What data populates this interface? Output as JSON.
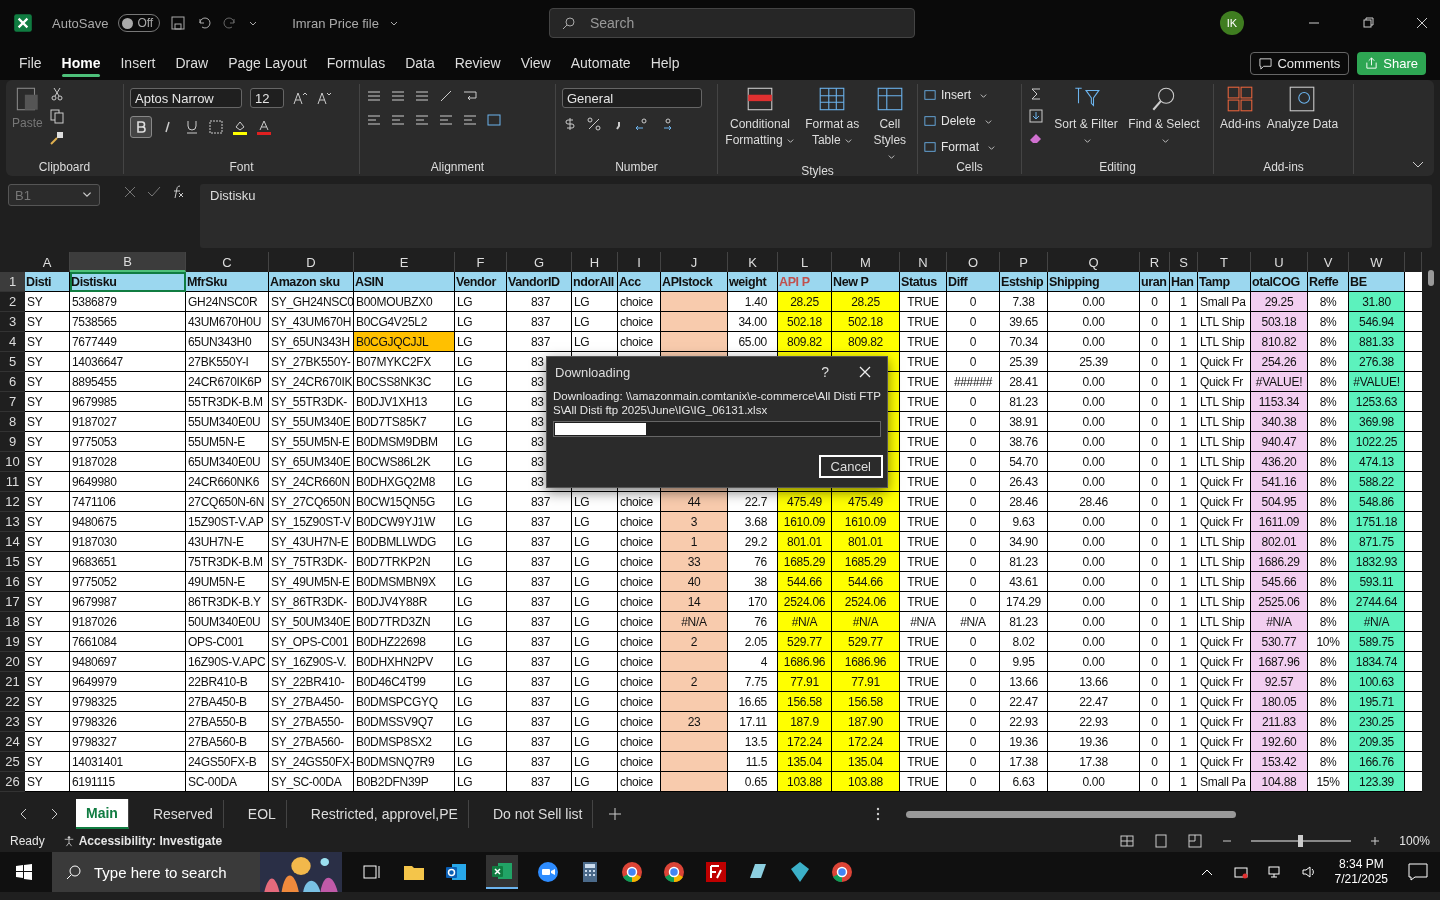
{
  "title_bar": {
    "autosave_label": "AutoSave",
    "autosave_on": false,
    "autosave_state": "Off",
    "file_name": "Imran Price file",
    "search_placeholder": "Search",
    "avatar": "IK"
  },
  "menu_tabs": [
    {
      "label": "File",
      "selected": false
    },
    {
      "label": "Home",
      "selected": true
    },
    {
      "label": "Insert",
      "selected": false
    },
    {
      "label": "Draw",
      "selected": false
    },
    {
      "label": "Page Layout",
      "selected": false
    },
    {
      "label": "Formulas",
      "selected": false
    },
    {
      "label": "Data",
      "selected": false
    },
    {
      "label": "Review",
      "selected": false
    },
    {
      "label": "View",
      "selected": false
    },
    {
      "label": "Automate",
      "selected": false
    },
    {
      "label": "Help",
      "selected": false
    }
  ],
  "comments_button": "Comments",
  "share_button": "Share",
  "ribbon": {
    "clipboard": {
      "paste": "Paste",
      "paste_disabled": true,
      "label": "Clipboard"
    },
    "font": {
      "family": "Aptos Narrow",
      "size": "12",
      "bold": true,
      "label": "Font"
    },
    "alignment": {
      "label": "Alignment"
    },
    "number": {
      "format": "General",
      "label": "Number"
    },
    "styles": {
      "buttons": [
        "Conditional Formatting",
        "Format as Table",
        "Cell Styles"
      ],
      "label": "Styles"
    },
    "cells": {
      "buttons": [
        "Insert",
        "Delete",
        "Format"
      ],
      "label": "Cells"
    },
    "editing": {
      "buttons": [
        "Sort & Filter",
        "Find & Select"
      ],
      "label": "Editing"
    },
    "addins": {
      "buttons": [
        "Add-ins",
        "Analyze Data"
      ],
      "label": "Add-ins"
    }
  },
  "formula_bar": {
    "name_box": "B1",
    "content": "Distisku"
  },
  "columns": [
    {
      "letter": "A",
      "header": "Disti",
      "selected": false
    },
    {
      "letter": "B",
      "header": "Distisku",
      "selected": true
    },
    {
      "letter": "C",
      "header": "MfrSku",
      "selected": false
    },
    {
      "letter": "D",
      "header": "Amazon sku",
      "selected": false
    },
    {
      "letter": "E",
      "header": "ASIN",
      "selected": false
    },
    {
      "letter": "F",
      "header": "Vendor",
      "selected": false
    },
    {
      "letter": "G",
      "header": "VandorID",
      "selected": false
    },
    {
      "letter": "H",
      "header": "ndorAll",
      "selected": false
    },
    {
      "letter": "I",
      "header": "Acc",
      "selected": false
    },
    {
      "letter": "J",
      "header": "APIstock",
      "selected": false,
      "color": "#f8cbad"
    },
    {
      "letter": "K",
      "header": "weight",
      "selected": false
    },
    {
      "letter": "L",
      "header": "API P",
      "selected": false,
      "color": "#ffff00",
      "header_emphasis": true
    },
    {
      "letter": "M",
      "header": "New P",
      "selected": false,
      "color": "#ffff00"
    },
    {
      "letter": "N",
      "header": "Status",
      "selected": false
    },
    {
      "letter": "O",
      "header": "Diff",
      "selected": false
    },
    {
      "letter": "P",
      "header": "Estship",
      "selected": false
    },
    {
      "letter": "Q",
      "header": "Shipping",
      "selected": false
    },
    {
      "letter": "R",
      "header": "uran",
      "selected": false
    },
    {
      "letter": "S",
      "header": "Han",
      "selected": false
    },
    {
      "letter": "T",
      "header": "Tamp",
      "selected": false
    },
    {
      "letter": "U",
      "header": "otalCOG",
      "selected": false,
      "color": "#f2cef0"
    },
    {
      "letter": "V",
      "header": "Reffe",
      "selected": false
    },
    {
      "letter": "W",
      "header": "BE",
      "selected": false,
      "color": "#5cf2bd"
    }
  ],
  "rows": [
    {
      "n": "2",
      "cells": [
        "SY",
        "5386879",
        "GH24NSC0R",
        "SY_GH24NSC0",
        "B00MOUBZX0",
        "LG",
        "837",
        "LG",
        "choice",
        null,
        "1.40",
        "28.25",
        "28.25",
        "TRUE",
        "0",
        "7.38",
        "0.00",
        "0",
        "1",
        "Small Pa",
        "29.25",
        "8%",
        "31.80"
      ]
    },
    {
      "n": "3",
      "cells": [
        "SY",
        "7538565",
        "43UM670H0U",
        "SY_43UM670H",
        "B0CG4V25L2",
        "LG",
        "837",
        "LG",
        "choice",
        null,
        "34.00",
        "502.18",
        "502.18",
        "TRUE",
        "0",
        "39.65",
        "0.00",
        "0",
        "1",
        "LTL Ship",
        "503.18",
        "8%",
        "546.94"
      ]
    },
    {
      "n": "4",
      "cells": [
        "SY",
        "7677449",
        "65UN343H0",
        "SY_65UN343H",
        {
          "text": "B0CGJQCJJL",
          "highlighted": true
        },
        "LG",
        "837",
        "LG",
        "choice",
        null,
        "65.00",
        "809.82",
        "809.82",
        "TRUE",
        "0",
        "70.34",
        "0.00",
        "0",
        "1",
        "LTL Ship",
        "810.82",
        "8%",
        "881.33"
      ]
    },
    {
      "n": "5",
      "cells": [
        "SY",
        "14036647",
        "27BK550Y-I",
        "SY_27BK550Y-",
        "B07MYKC2FX",
        "LG",
        "83",
        null,
        null,
        null,
        null,
        null,
        null,
        "TRUE",
        "0",
        "25.39",
        "25.39",
        "0",
        "1",
        "Quick Fr",
        "254.26",
        "8%",
        "276.38"
      ]
    },
    {
      "n": "6",
      "cells": [
        "SY",
        "8895455",
        "24CR670IK6P",
        "SY_24CR670IK",
        "B0CSS8NK3C",
        "LG",
        "83",
        null,
        null,
        null,
        null,
        null,
        null,
        "TRUE",
        "######",
        "28.41",
        "0.00",
        "0",
        "1",
        "Quick Fr",
        "#VALUE!",
        "8%",
        "#VALUE!"
      ]
    },
    {
      "n": "7",
      "cells": [
        "SY",
        "9679985",
        "55TR3DK-B.M",
        "SY_55TR3DK-",
        "B0DJV1XH13",
        "LG",
        "83",
        null,
        null,
        null,
        null,
        null,
        null,
        "TRUE",
        "0",
        "81.23",
        "0.00",
        "0",
        "1",
        "LTL Ship",
        "1153.34",
        "8%",
        "1253.63"
      ]
    },
    {
      "n": "8",
      "cells": [
        "SY",
        "9187027",
        "55UM340E0U",
        "SY_55UM340E",
        "B0D7TS85K7",
        "LG",
        "83",
        null,
        null,
        null,
        null,
        null,
        null,
        "TRUE",
        "0",
        "38.91",
        "0.00",
        "0",
        "1",
        "LTL Ship",
        "340.38",
        "8%",
        "369.98"
      ]
    },
    {
      "n": "9",
      "cells": [
        "SY",
        "9775053",
        "55UM5N-E",
        "SY_55UM5N-E",
        "B0DMSM9DBM",
        "LG",
        "83",
        null,
        null,
        null,
        null,
        null,
        null,
        "TRUE",
        "0",
        "38.76",
        "0.00",
        "0",
        "1",
        "LTL Ship",
        "940.47",
        "8%",
        "1022.25"
      ]
    },
    {
      "n": "10",
      "cells": [
        "SY",
        "9187028",
        "65UM340E0U",
        "SY_65UM340E",
        "B0CWS86L2K",
        "LG",
        "83",
        null,
        null,
        null,
        null,
        null,
        null,
        "TRUE",
        "0",
        "54.70",
        "0.00",
        "0",
        "1",
        "LTL Ship",
        "436.20",
        "8%",
        "474.13"
      ]
    },
    {
      "n": "11",
      "cells": [
        "SY",
        "9649980",
        "24CR660NK6",
        "SY_24CR660N",
        "B0DHXGQ2M8",
        "LG",
        "83",
        null,
        null,
        null,
        null,
        null,
        null,
        "TRUE",
        "0",
        "26.43",
        "0.00",
        "0",
        "1",
        "Quick Fr",
        "541.16",
        "8%",
        "588.22"
      ]
    },
    {
      "n": "12",
      "cells": [
        "SY",
        "7471106",
        "27CQ650N-6N",
        "SY_27CQ650N",
        "B0CW15QN5G",
        "LG",
        "837",
        "LG",
        "choice",
        "44",
        "22.7",
        "475.49",
        "475.49",
        "TRUE",
        "0",
        "28.46",
        "28.46",
        "0",
        "1",
        "Quick Fr",
        "504.95",
        "8%",
        "548.86"
      ]
    },
    {
      "n": "13",
      "cells": [
        "SY",
        "9480675",
        "15Z90ST-V.AP",
        "SY_15Z90ST-V",
        "B0DCW9YJ1W",
        "LG",
        "837",
        "LG",
        "choice",
        "3",
        "3.68",
        "1610.09",
        "1610.09",
        "TRUE",
        "0",
        "9.63",
        "0.00",
        "0",
        "1",
        "Quick Fr",
        "1611.09",
        "8%",
        "1751.18"
      ]
    },
    {
      "n": "14",
      "cells": [
        "SY",
        "9187030",
        "43UH7N-E",
        "SY_43UH7N-E",
        "B0DBMLLWDG",
        "LG",
        "837",
        "LG",
        "choice",
        "1",
        "29.2",
        "801.01",
        "801.01",
        "TRUE",
        "0",
        "34.90",
        "0.00",
        "0",
        "1",
        "LTL Ship",
        "802.01",
        "8%",
        "871.75"
      ]
    },
    {
      "n": "15",
      "cells": [
        "SY",
        "9683651",
        "75TR3DK-B.M",
        "SY_75TR3DK-",
        "B0D7TRKP2N",
        "LG",
        "837",
        "LG",
        "choice",
        "33",
        "76",
        "1685.29",
        "1685.29",
        "TRUE",
        "0",
        "81.23",
        "0.00",
        "0",
        "1",
        "LTL Ship",
        "1686.29",
        "8%",
        "1832.93"
      ]
    },
    {
      "n": "16",
      "cells": [
        "SY",
        "9775052",
        "49UM5N-E",
        "SY_49UM5N-E",
        "B0DMSMBN9X",
        "LG",
        "837",
        "LG",
        "choice",
        "40",
        "38",
        "544.66",
        "544.66",
        "TRUE",
        "0",
        "43.61",
        "0.00",
        "0",
        "1",
        "LTL Ship",
        "545.66",
        "8%",
        "593.11"
      ]
    },
    {
      "n": "17",
      "cells": [
        "SY",
        "9679987",
        "86TR3DK-B.Y",
        "SY_86TR3DK-",
        "B0DJV4Y88R",
        "LG",
        "837",
        "LG",
        "choice",
        "14",
        "170",
        "2524.06",
        "2524.06",
        "TRUE",
        "0",
        "174.29",
        "0.00",
        "0",
        "1",
        "LTL Ship",
        "2525.06",
        "8%",
        "2744.64"
      ]
    },
    {
      "n": "18",
      "cells": [
        "SY",
        "9187026",
        "50UM340E0U",
        "SY_50UM340E",
        "B0D7TRD3ZN",
        "LG",
        "837",
        "LG",
        "choice",
        "#N/A",
        "76",
        "#N/A",
        "#N/A",
        "#N/A",
        "#N/A",
        "81.23",
        "0.00",
        "0",
        "1",
        "LTL Ship",
        "#N/A",
        "8%",
        "#N/A"
      ]
    },
    {
      "n": "19",
      "cells": [
        "SY",
        "7661084",
        "OPS-C001",
        "SY_OPS-C001",
        "B0DHZ22698",
        "LG",
        "837",
        "LG",
        "choice",
        "2",
        "2.05",
        "529.77",
        "529.77",
        "TRUE",
        "0",
        "8.02",
        "0.00",
        "0",
        "1",
        "Quick Fr",
        "530.77",
        "10%",
        "589.75"
      ]
    },
    {
      "n": "20",
      "cells": [
        "SY",
        "9480697",
        "16Z90S-V.APC",
        "SY_16Z90S-V.",
        "B0DHXHN2PV",
        "LG",
        "837",
        "LG",
        "choice",
        null,
        "4",
        "1686.96",
        "1686.96",
        "TRUE",
        "0",
        "9.95",
        "0.00",
        "0",
        "1",
        "Quick Fr",
        "1687.96",
        "8%",
        "1834.74"
      ]
    },
    {
      "n": "21",
      "cells": [
        "SY",
        "9649979",
        "22BR410-B",
        "SY_22BR410-",
        "B0D46C4T99",
        "LG",
        "837",
        "LG",
        "choice",
        "2",
        "7.75",
        "77.91",
        "77.91",
        "TRUE",
        "0",
        "13.66",
        "13.66",
        "0",
        "1",
        "Quick Fr",
        "92.57",
        "8%",
        "100.63"
      ]
    },
    {
      "n": "22",
      "cells": [
        "SY",
        "9798325",
        "27BA450-B",
        "SY_27BA450-",
        "B0DMSPCGYQ",
        "LG",
        "837",
        "LG",
        "choice",
        null,
        "16.65",
        "156.58",
        "156.58",
        "TRUE",
        "0",
        "22.47",
        "22.47",
        "0",
        "1",
        "Quick Fr",
        "180.05",
        "8%",
        "195.71"
      ]
    },
    {
      "n": "23",
      "cells": [
        "SY",
        "9798326",
        "27BA550-B",
        "SY_27BA550-",
        "B0DMSSV9Q7",
        "LG",
        "837",
        "LG",
        "choice",
        "23",
        "17.11",
        "187.9",
        "187.90",
        "TRUE",
        "0",
        "22.93",
        "22.93",
        "0",
        "1",
        "Quick Fr",
        "211.83",
        "8%",
        "230.25"
      ]
    },
    {
      "n": "24",
      "cells": [
        "SY",
        "9798327",
        "27BA560-B",
        "SY_27BA560-",
        "B0DMSP8SX2",
        "LG",
        "837",
        "LG",
        "choice",
        null,
        "13.5",
        "172.24",
        "172.24",
        "TRUE",
        "0",
        "19.36",
        "19.36",
        "0",
        "1",
        "Quick Fr",
        "192.60",
        "8%",
        "209.35"
      ]
    },
    {
      "n": "25",
      "cells": [
        "SY",
        "14031401",
        "24GS50FX-B",
        "SY_24GS50FX-",
        "B0DMSNQ7R9",
        "LG",
        "837",
        "LG",
        "choice",
        null,
        "11.5",
        "135.04",
        "135.04",
        "TRUE",
        "0",
        "17.38",
        "17.38",
        "0",
        "1",
        "Quick Fr",
        "153.42",
        "8%",
        "166.76"
      ]
    },
    {
      "n": "26",
      "cells": [
        "SY",
        "6191115",
        "SC-00DA",
        "SY_SC-00DA",
        "B0B2DFN39P",
        "LG",
        "837",
        "LG",
        "choice",
        null,
        "0.65",
        "103.88",
        "103.88",
        "TRUE",
        "0",
        "6.63",
        "0.00",
        "0",
        "1",
        "Small Pa",
        "104.88",
        "15%",
        "123.39"
      ]
    }
  ],
  "header_row_number": "1",
  "dialog": {
    "title": "Downloading",
    "help": "?",
    "message": "Downloading: \\\\amazonmain.comtanix\\e-commerce\\All Disti FTPS\\All Disti ftp 2025\\June\\IG\\IG_06131.xlsx",
    "level": 0.28,
    "cancel": "Cancel"
  },
  "sheet_tabs": [
    {
      "label": "Main",
      "selected": true
    },
    {
      "label": "Reserved",
      "selected": false
    },
    {
      "label": "EOL",
      "selected": false
    },
    {
      "label": "Restricted, approvel,PE",
      "selected": false
    },
    {
      "label": "Do not Sell list",
      "selected": false
    }
  ],
  "status_bar": {
    "mode": "Ready",
    "accessibility": "Accessibility: Investigate",
    "zoom_slider": {
      "level": 0.5
    },
    "zoom": "100%"
  },
  "taskbar": {
    "search_placeholder": "Type here to search",
    "time": "8:34 PM",
    "date": "7/21/2025"
  }
}
